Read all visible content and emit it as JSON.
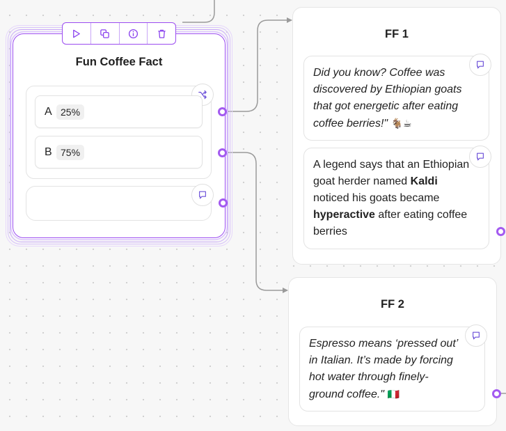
{
  "toolbar": {
    "icons": [
      "play-icon",
      "duplicate-icon",
      "info-icon",
      "trash-icon"
    ],
    "accent": "#9b4cf0"
  },
  "main_block": {
    "title": "Fun Coffee Fact",
    "paths": [
      {
        "name": "A",
        "percent": "25%"
      },
      {
        "name": "B",
        "percent": "75%"
      }
    ]
  },
  "ff1": {
    "title": "FF 1",
    "message1": "Did you know? Coffee was discovered by Ethiopian goats that got energetic after eating coffee berries!\"",
    "message1_emoji": "🐐☕",
    "message2": {
      "part1": "A legend says that an Ethiopian goat herder named ",
      "bold1": "Kaldi",
      "part2": " noticed his goats became ",
      "bold2": "hyperactive",
      "part3": " after eating coffee berries"
    }
  },
  "ff2": {
    "title": "FF 2",
    "message": "Espresso means ‘pressed out’ in Italian. It’s made by forcing hot water through finely-ground coffee.\"",
    "message_emoji": "🇮🇹"
  },
  "colors": {
    "port": "#a35af0",
    "edge": "#9a9a9a",
    "icon": "#6b4fd8"
  }
}
